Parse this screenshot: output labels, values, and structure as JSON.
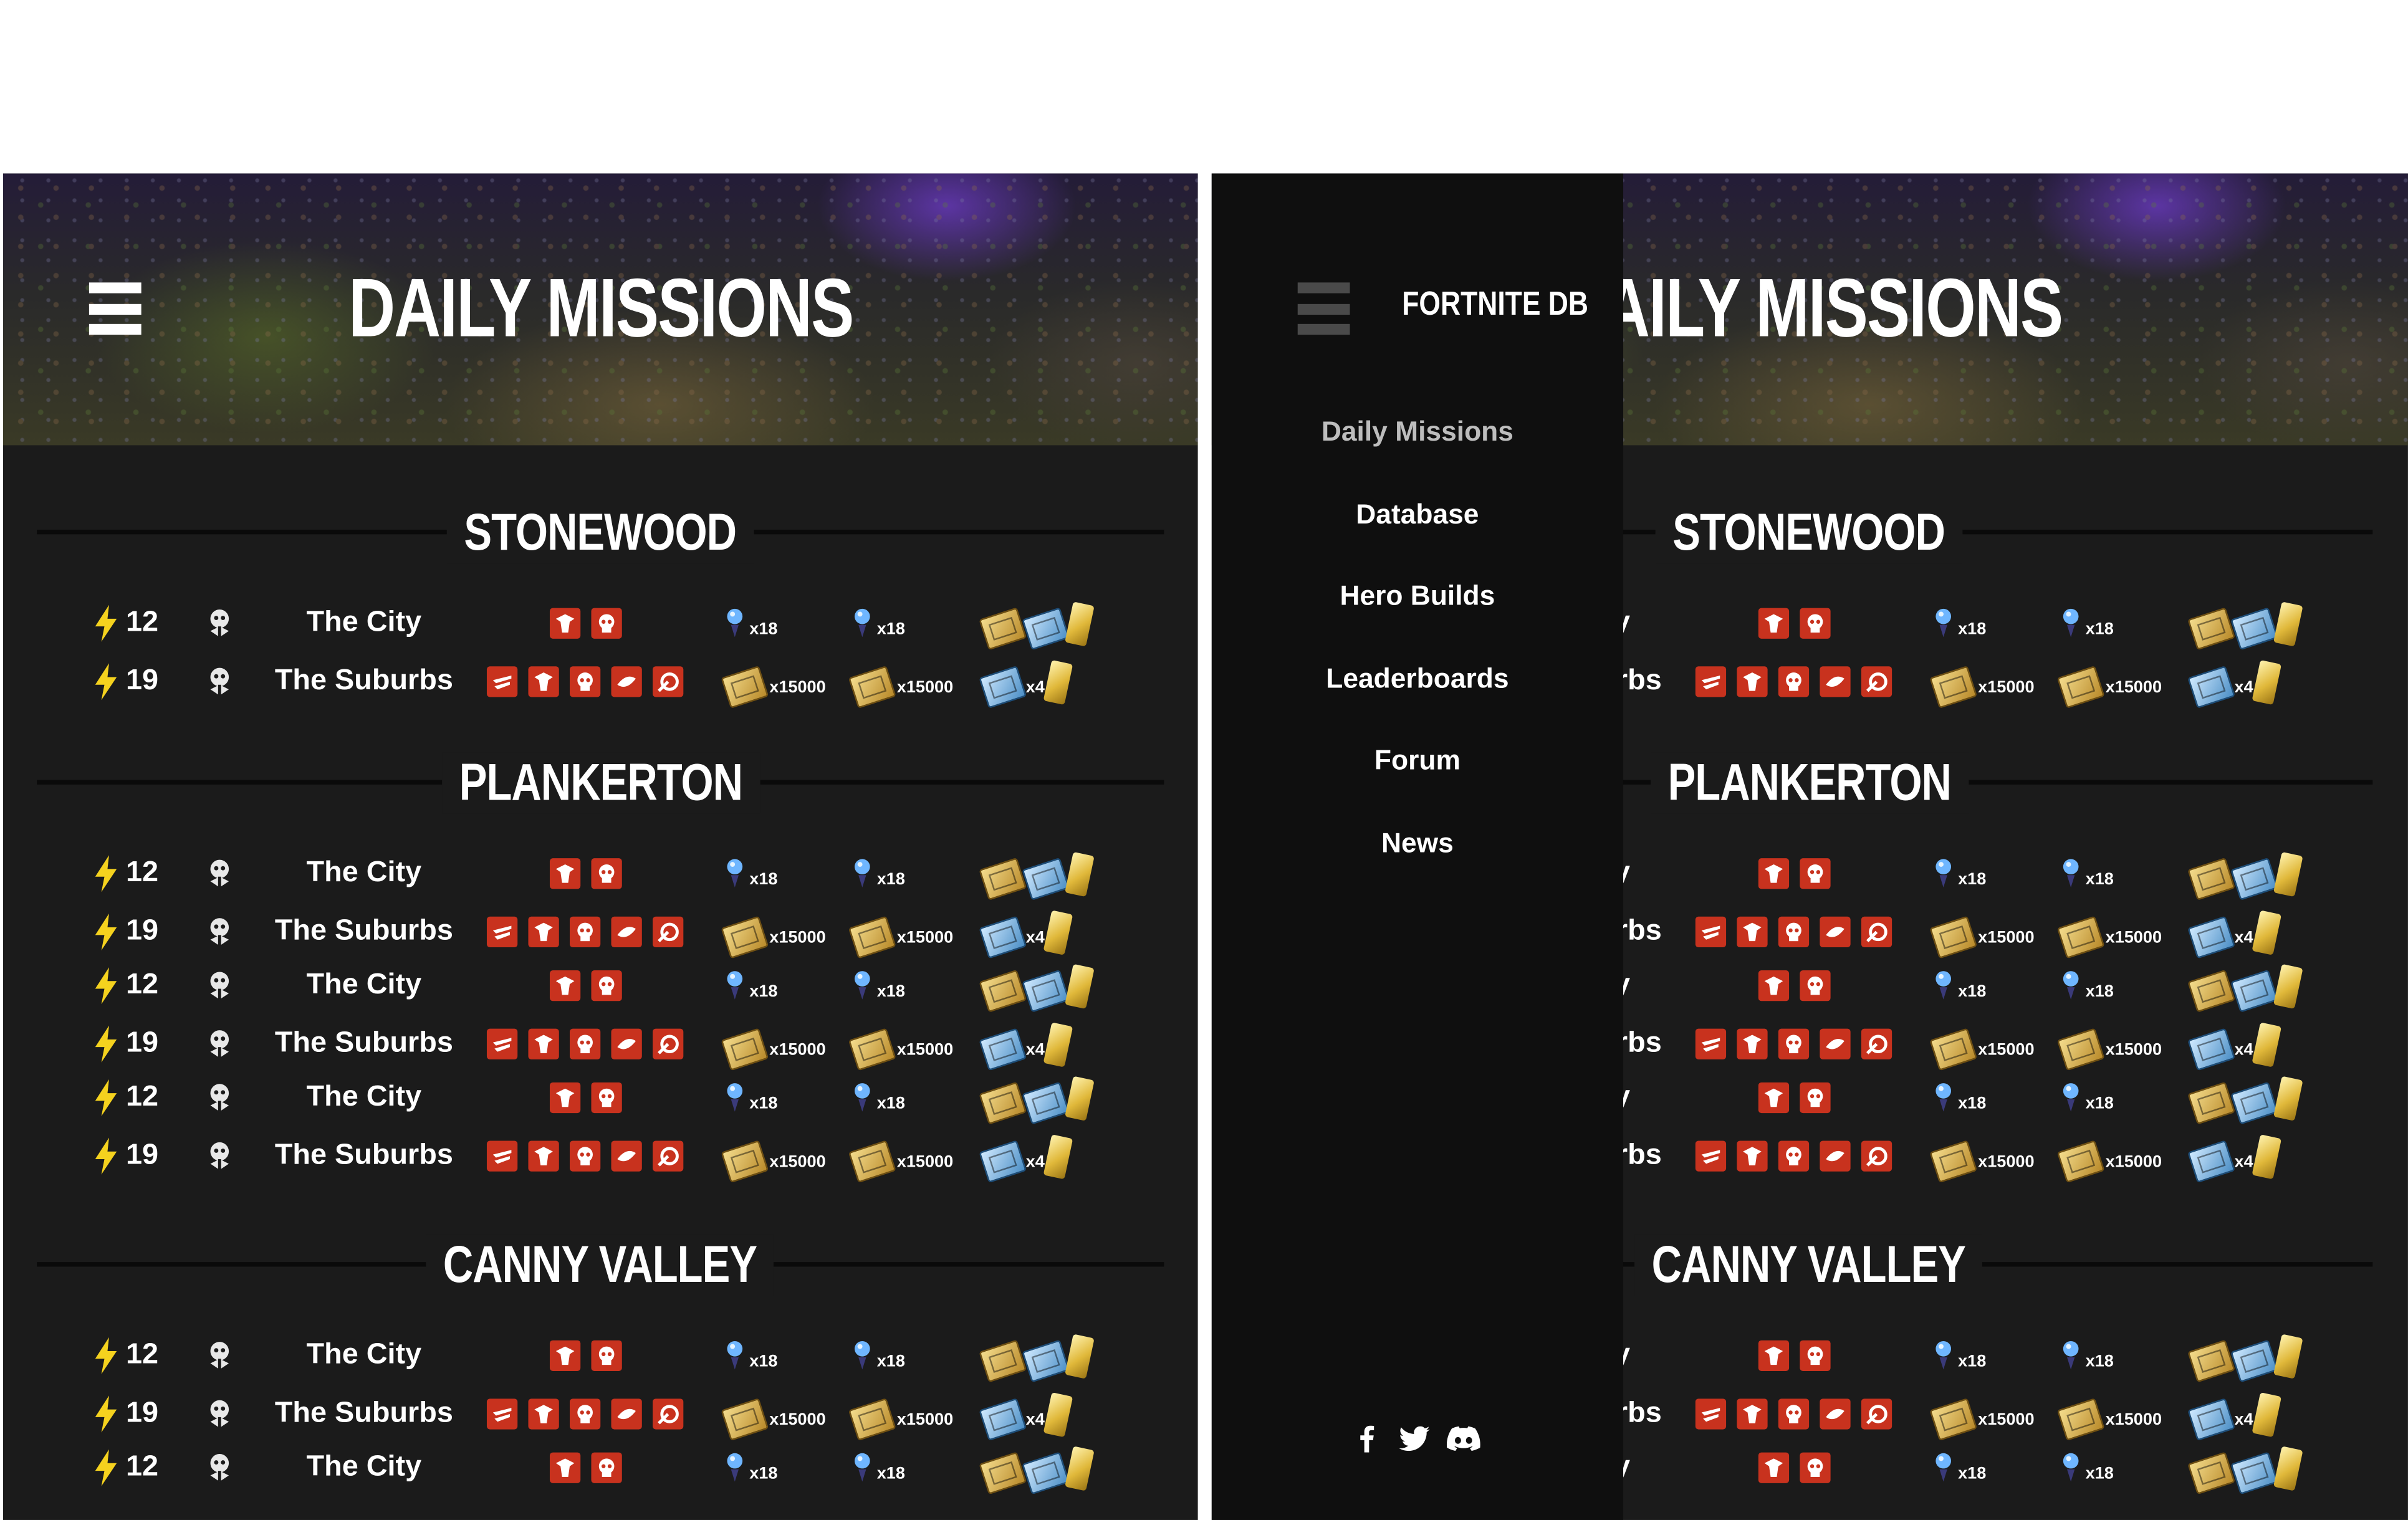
{
  "header": {
    "title": "DAILY MISSIONS"
  },
  "sidebar": {
    "brand": "FORTNITE DB",
    "items": [
      {
        "label": "Daily Missions",
        "active": true
      },
      {
        "label": "Database"
      },
      {
        "label": "Hero Builds"
      },
      {
        "label": "Leaderboards"
      },
      {
        "label": "Forum"
      },
      {
        "label": "News"
      }
    ],
    "social": [
      "facebook-icon",
      "twitter-icon",
      "discord-icon"
    ]
  },
  "regions": [
    {
      "name": "STONEWOOD",
      "missions": [
        {
          "power": "12",
          "zone": "The City",
          "mods": [
            "mod-a",
            "mod-b"
          ],
          "reward1": "x18",
          "reward2": "x18",
          "reward3": [
            "gold-ticket",
            "blue-ticket",
            "gold-bar"
          ]
        },
        {
          "power": "19",
          "zone": "The Suburbs",
          "mods": [
            "mod-c",
            "mod-a",
            "mod-b",
            "mod-d",
            "mod-e"
          ],
          "reward1": "x15000",
          "reward2": "x15000",
          "reward3": [
            "blue-ticket",
            "gold-bar"
          ],
          "reward3_mult": "x4"
        }
      ]
    },
    {
      "name": "PLANKERTON",
      "missions": [
        {
          "power": "12",
          "zone": "The City",
          "mods": [
            "mod-a",
            "mod-b"
          ],
          "reward1": "x18",
          "reward2": "x18",
          "reward3": [
            "gold-ticket",
            "blue-ticket",
            "gold-bar"
          ]
        },
        {
          "power": "19",
          "zone": "The Suburbs",
          "mods": [
            "mod-c",
            "mod-a",
            "mod-b",
            "mod-d",
            "mod-e"
          ],
          "reward1": "x15000",
          "reward2": "x15000",
          "reward3": [
            "blue-ticket",
            "gold-bar"
          ],
          "reward3_mult": "x4"
        },
        {
          "power": "12",
          "zone": "The City",
          "mods": [
            "mod-a",
            "mod-b"
          ],
          "reward1": "x18",
          "reward2": "x18",
          "reward3": [
            "gold-ticket",
            "blue-ticket",
            "gold-bar"
          ]
        },
        {
          "power": "19",
          "zone": "The Suburbs",
          "mods": [
            "mod-c",
            "mod-a",
            "mod-b",
            "mod-d",
            "mod-e"
          ],
          "reward1": "x15000",
          "reward2": "x15000",
          "reward3": [
            "blue-ticket",
            "gold-bar"
          ],
          "reward3_mult": "x4"
        },
        {
          "power": "12",
          "zone": "The City",
          "mods": [
            "mod-a",
            "mod-b"
          ],
          "reward1": "x18",
          "reward2": "x18",
          "reward3": [
            "gold-ticket",
            "blue-ticket",
            "gold-bar"
          ]
        },
        {
          "power": "19",
          "zone": "The Suburbs",
          "mods": [
            "mod-c",
            "mod-a",
            "mod-b",
            "mod-d",
            "mod-e"
          ],
          "reward1": "x15000",
          "reward2": "x15000",
          "reward3": [
            "blue-ticket",
            "gold-bar"
          ],
          "reward3_mult": "x4"
        }
      ]
    },
    {
      "name": "CANNY VALLEY",
      "missions": [
        {
          "power": "12",
          "zone": "The City",
          "mods": [
            "mod-a",
            "mod-b"
          ],
          "reward1": "x18",
          "reward2": "x18",
          "reward3": [
            "gold-ticket",
            "blue-ticket",
            "gold-bar"
          ]
        },
        {
          "power": "19",
          "zone": "The Suburbs",
          "mods": [
            "mod-c",
            "mod-a",
            "mod-b",
            "mod-d",
            "mod-e"
          ],
          "reward1": "x15000",
          "reward2": "x15000",
          "reward3": [
            "blue-ticket",
            "gold-bar"
          ],
          "reward3_mult": "x4"
        },
        {
          "power": "12",
          "zone": "The City",
          "mods": [
            "mod-a",
            "mod-b"
          ],
          "reward1": "x18",
          "reward2": "x18",
          "reward3": [
            "gold-ticket",
            "blue-ticket",
            "gold-bar"
          ]
        }
      ]
    }
  ],
  "colors": {
    "background": "#1b1b1b",
    "sidebar": "#0f0f0f",
    "modifier": "#c8321e",
    "power-bolt": "#f5d21e",
    "reward-gold": "#e0b83a",
    "reward-blue": "#4c8fc6"
  }
}
